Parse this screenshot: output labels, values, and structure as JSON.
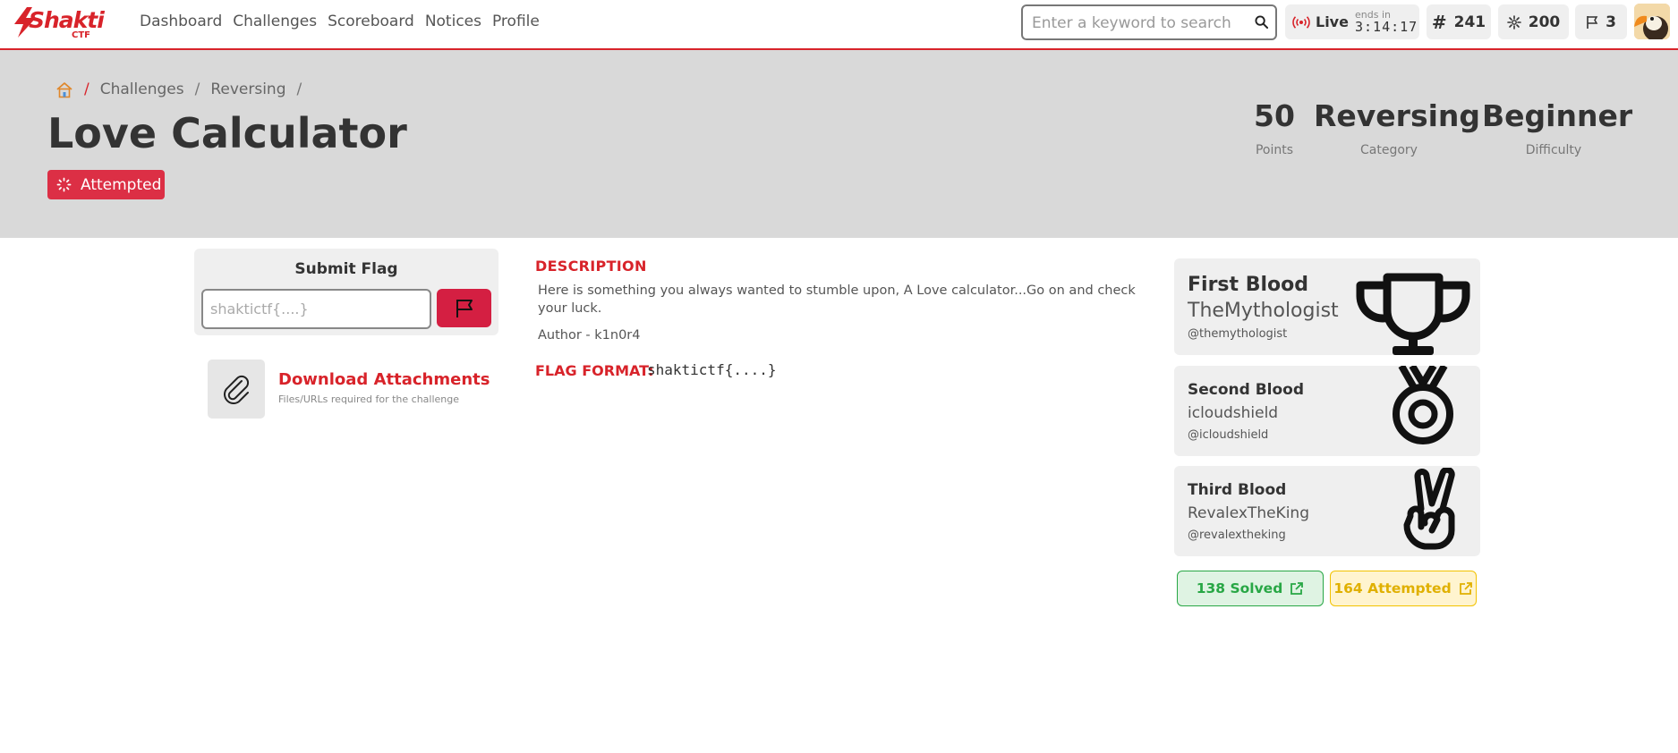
{
  "nav": {
    "brand": "Shakti",
    "brand_sub": "CTF",
    "links": [
      "Dashboard",
      "Challenges",
      "Scoreboard",
      "Notices",
      "Profile"
    ],
    "search_placeholder": "Enter a keyword to search",
    "live_label": "Live",
    "ends_label": "ends in",
    "ends_time": "3:14:17",
    "rank": "241",
    "points": "200",
    "flags": "3"
  },
  "breadcrumb": [
    "Challenges",
    "Reversing"
  ],
  "challenge": {
    "title": "Love Calculator",
    "status": "Attempted",
    "stats": [
      {
        "value": "50",
        "label": "Points"
      },
      {
        "value": "Reversing",
        "label": "Category"
      },
      {
        "value": "Beginner",
        "label": "Difficulty"
      }
    ]
  },
  "submit": {
    "title": "Submit Flag",
    "placeholder": "shaktictf{....}"
  },
  "attachments": {
    "title": "Download Attachments",
    "subtitle": "Files/URLs required for the challenge"
  },
  "description": {
    "heading": "DESCRIPTION",
    "text": "Here is something you always wanted to stumble upon, A Love calculator...Go on and check your luck.",
    "author": "Author - k1n0r4",
    "flag_format_label": "FLAG FORMAT:",
    "flag_format_value": "shaktictf{....}"
  },
  "bloods": [
    {
      "rank": "First Blood",
      "user": "TheMythologist",
      "handle": "@themythologist",
      "icon": "trophy-icon"
    },
    {
      "rank": "Second Blood",
      "user": "icloudshield",
      "handle": "@icloudshield",
      "icon": "medal-icon"
    },
    {
      "rank": "Third Blood",
      "user": "RevalexTheKing",
      "handle": "@revalextheking",
      "icon": "victory-hand-icon"
    }
  ],
  "counts": {
    "solved": "138 Solved",
    "attempted": "164 Attempted"
  },
  "colors": {
    "accent": "#d8232a",
    "status_badge": "#dc2f45",
    "solved": "#28a745",
    "attempted": "#e0b000"
  }
}
